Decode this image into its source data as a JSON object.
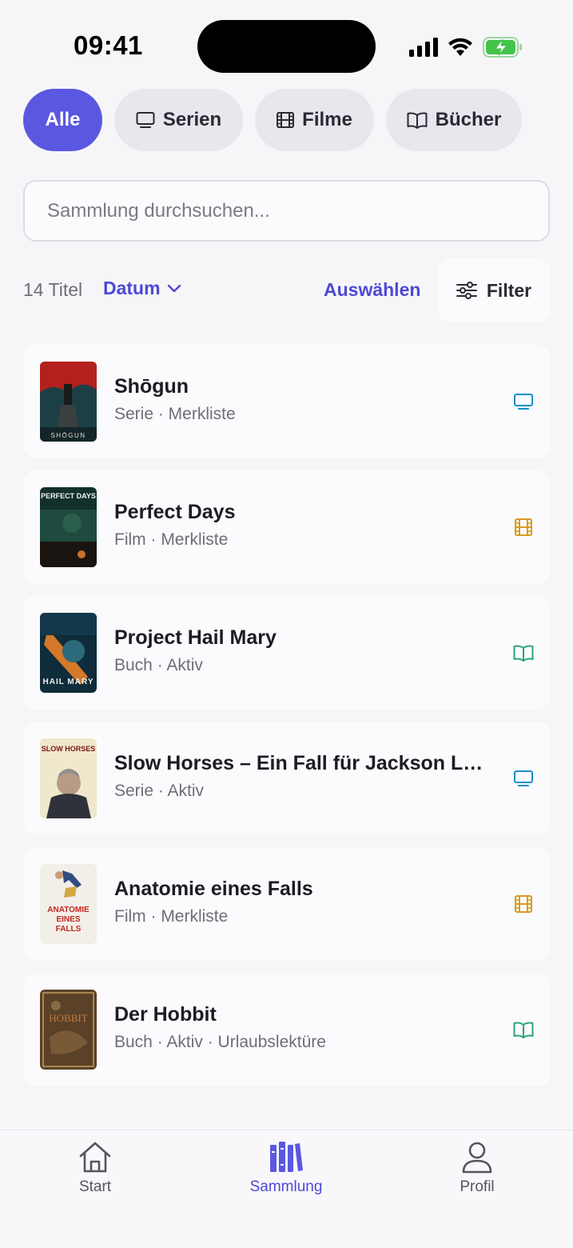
{
  "status_bar": {
    "time": "09:41"
  },
  "filter_chips": [
    {
      "label": "Alle",
      "icon": "none",
      "active": true
    },
    {
      "label": "Serien",
      "icon": "tv-icon",
      "active": false
    },
    {
      "label": "Filme",
      "icon": "film-icon",
      "active": false
    },
    {
      "label": "Bücher",
      "icon": "book-icon",
      "active": false
    }
  ],
  "search": {
    "placeholder": "Sammlung durchsuchen...",
    "value": ""
  },
  "toolbar": {
    "count": "14 Titel",
    "sort_label": "Datum",
    "select_label": "Auswählen",
    "filter_label": "Filter"
  },
  "items": [
    {
      "title": "Shōgun",
      "meta": "Serie · Merkliste",
      "type_icon": "tv-icon",
      "cover_text": "SHŌGUN"
    },
    {
      "title": "Perfect Days",
      "meta": "Film · Merkliste",
      "type_icon": "film-icon",
      "cover_text": "PERFECT DAYS"
    },
    {
      "title": "Project Hail Mary",
      "meta": "Buch · Aktiv",
      "type_icon": "book-icon",
      "cover_text": "HAIL MARY"
    },
    {
      "title": "Slow Horses – Ein Fall für Jackson La...",
      "meta": "Serie · Aktiv",
      "type_icon": "tv-icon",
      "cover_text": "SLOW HORSES"
    },
    {
      "title": "Anatomie eines Falls",
      "meta": "Film · Merkliste",
      "type_icon": "film-icon",
      "cover_text": "ANATOMIE EINES FALLS"
    },
    {
      "title": "Der Hobbit",
      "meta": "Buch · Aktiv · Urlaubslektüre",
      "type_icon": "book-icon",
      "cover_text": "HOBBIT"
    }
  ],
  "nav": [
    {
      "label": "Start",
      "icon": "home-icon",
      "active": false
    },
    {
      "label": "Sammlung",
      "icon": "library-icon",
      "active": true
    },
    {
      "label": "Profil",
      "icon": "profile-icon",
      "active": false
    }
  ],
  "colors": {
    "accent": "#5b57e0",
    "accent_text": "#4d49d6",
    "tv": "#1a8fc9",
    "film": "#d99a1e",
    "book": "#2aa579"
  }
}
